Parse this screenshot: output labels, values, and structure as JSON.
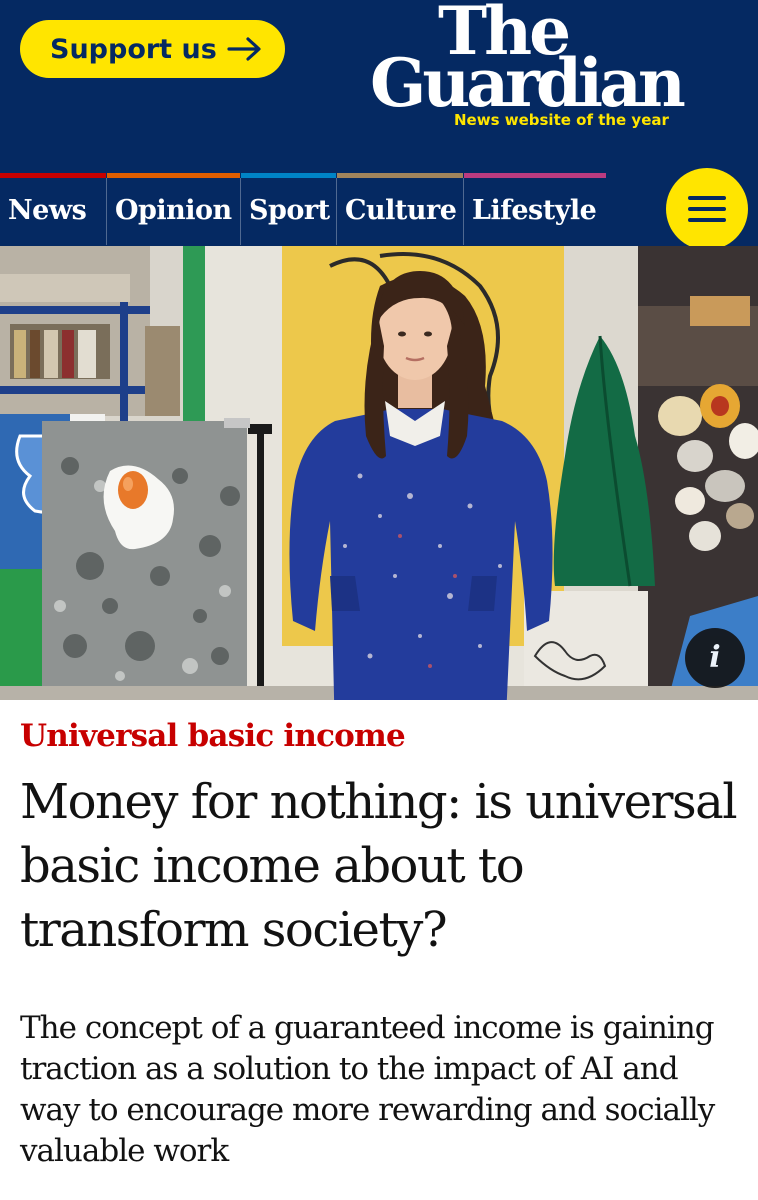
{
  "header": {
    "support_label": "Support us",
    "logo_line1": "The",
    "logo_line2": "Guardian",
    "tagline": "News website of the year"
  },
  "nav": {
    "items": [
      {
        "label": "News",
        "color": "#c70000"
      },
      {
        "label": "Opinion",
        "color": "#e05e00"
      },
      {
        "label": "Sport",
        "color": "#0084c6"
      },
      {
        "label": "Culture",
        "color": "#a1845c"
      },
      {
        "label": "Lifestyle",
        "color": "#bb3b80"
      }
    ],
    "menu_icon": "hamburger-icon"
  },
  "hero": {
    "info_label": "i",
    "info_icon": "info-icon"
  },
  "article": {
    "kicker": "Universal basic income",
    "headline": "Money for nothing: is universal basic income about to transform society?",
    "standfirst": "The concept of a guaranteed income is gaining traction as a solution to the impact of AI and way to encourage more rewarding and socially valuable work"
  },
  "colors": {
    "brand_blue": "#052962",
    "brand_yellow": "#ffe500",
    "kicker_red": "#c70000",
    "text": "#121212"
  }
}
